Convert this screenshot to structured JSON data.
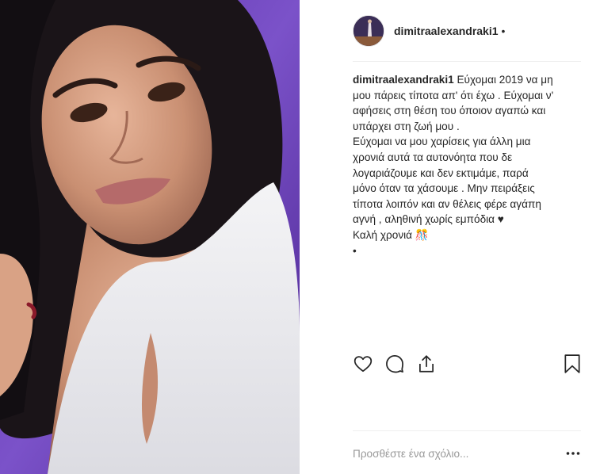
{
  "post": {
    "username": "dimitraalexandraki1",
    "separator": "•",
    "caption_user": "dimitraalexandraki1",
    "caption_text": " Εύχομαι 2019 να μη\nμου πάρεις τίποτα απ' ότι έχω . Εύχομαι ν'\nαφήσεις στη θέση του όποιον αγαπώ και\nυπάρχει στη ζωή μου .\nΕύχομαι να μου χαρίσεις για άλλη μια\nχρονιά αυτά τα αυτονόητα που δε\nλογαριάζουμε και δεν εκτιμάμε, παρά\nμόνο όταν τα χάσουμε . Μην πειράξεις\nτίποτα λοιπόν και αν θέλεις φέρε αγάπη\nαγνή , αληθινή χωρίς εμπόδια ♥\nΚαλή χρονιά 🎊\n•"
  },
  "icons": {
    "like": "heart-icon",
    "comment": "comment-icon",
    "share": "share-icon",
    "save": "bookmark-icon",
    "more": "more-options-icon"
  },
  "comment": {
    "placeholder": "Προσθέστε ένα σχόλιο..."
  },
  "colors": {
    "text": "#262626",
    "muted": "#999999",
    "divider": "#efefef",
    "photo_background": "#6b3fb8"
  }
}
